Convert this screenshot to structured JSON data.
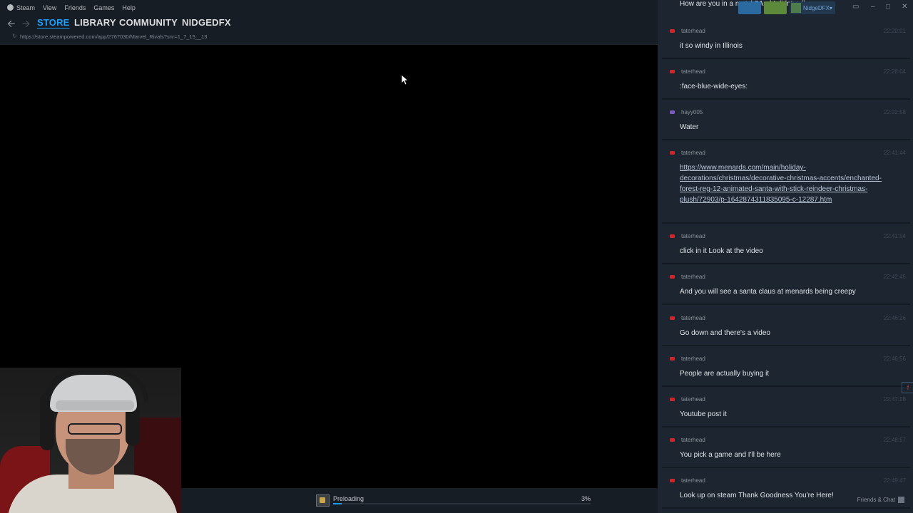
{
  "menubar": {
    "items": [
      "Steam",
      "View",
      "Friends",
      "Games",
      "Help"
    ]
  },
  "nav": {
    "tabs": [
      "STORE",
      "LIBRARY",
      "COMMUNITY",
      "NIDGEDFX"
    ],
    "active": "STORE"
  },
  "url": "https://store.steampowered.com/app/2767030/Marvel_Rivals?snr=1_7_15__13",
  "download": {
    "label": "Preloading",
    "percent_text": "3%",
    "progress": 0.03
  },
  "chat_header": {
    "user": "NidgeDFX"
  },
  "chat_first_line": "How are you in a match?And I didn't tell you",
  "messages": [
    {
      "platform": "youtube",
      "user": "taterhead",
      "time": "22:20:01",
      "text": "it so windy in Illinois"
    },
    {
      "platform": "youtube",
      "user": "taterhead",
      "time": "22:28:04",
      "text": ":face-blue-wide-eyes:"
    },
    {
      "platform": "twitch",
      "user": "hayy005",
      "time": "22:32:58",
      "text": "Water"
    },
    {
      "platform": "youtube",
      "user": "taterhead",
      "time": "22:41:44",
      "text": "https://www.menards.com/main/holiday-decorations/christmas/decorative-christmas-accents/enchanted-forest-reg-12-animated-santa-with-stick-reindeer-christmas-plush/72903/p-1642874311835095-c-12287.htm",
      "link": true
    },
    {
      "platform": "youtube",
      "user": "taterhead",
      "time": "22:41:54",
      "text": "click in it Look at the video"
    },
    {
      "platform": "youtube",
      "user": "taterhead",
      "time": "22:42:45",
      "text": "And you will see a santa claus at menards being creepy"
    },
    {
      "platform": "youtube",
      "user": "taterhead",
      "time": "22:46:26",
      "text": "Go down and there's a video"
    },
    {
      "platform": "youtube",
      "user": "taterhead",
      "time": "22:46:56",
      "text": "People are actually buying it"
    },
    {
      "platform": "youtube",
      "user": "taterhead",
      "time": "22:47:28",
      "text": "Youtube post it"
    },
    {
      "platform": "youtube",
      "user": "taterhead",
      "time": "22:48:57",
      "text": "You pick a game and I'll be here"
    },
    {
      "platform": "youtube",
      "user": "taterhead",
      "time": "22:49:47",
      "text": "Look up on steam Thank Goodness You're Here!"
    }
  ],
  "footer": {
    "friends_label": "Friends & Chat"
  },
  "colors": {
    "accent": "#1a9fff",
    "youtube": "#d0262b",
    "twitch": "#7d5bbe"
  }
}
